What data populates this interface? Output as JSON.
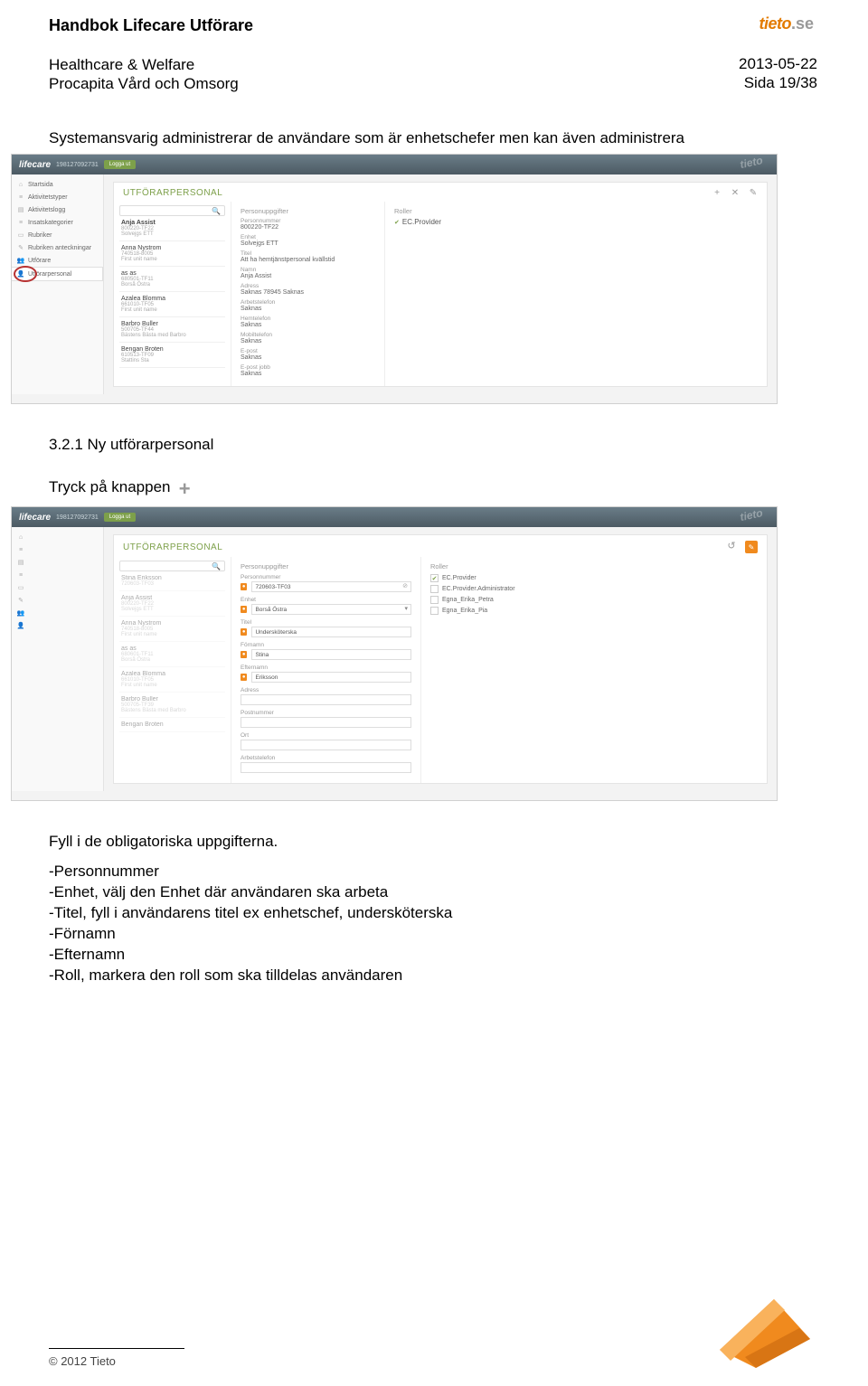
{
  "header": {
    "doc_title": "Handbok Lifecare Utförare",
    "division": "Healthcare & Welfare",
    "product": "Procapita Vård och Omsorg",
    "date": "2013-05-22",
    "page": "Sida 19/38",
    "logo_t": "tieto",
    "logo_se": ".se"
  },
  "intro": "Systemansvarig administrerar de användare som är enhetschefer men kan även administrera",
  "sec321_num": "3.2.1 Ny utförarpersonal",
  "tryck": "Tryck på knappen",
  "fyll": "Fyll i de obligatoriska uppgifterna.",
  "bullets": [
    "-Personnummer",
    "-Enhet, välj den Enhet där användaren ska arbeta",
    "-Titel, fyll i användarens titel ex enhetschef, undersköterska",
    "-Förnamn",
    "-Efternamn",
    "-Roll, markera den roll som ska tilldelas användaren"
  ],
  "footer": {
    "copyright": "© 2012 Tieto"
  },
  "app1": {
    "bar": {
      "logo": "lifecare",
      "code": "198127092731",
      "btn": "Logga ut"
    },
    "side": [
      "Startsida",
      "Aktivitetstyper",
      "Aktivitetslogg",
      "Insatskategorier",
      "Rubriker",
      "Rubriken anteckningar",
      "Utförare",
      "Utförarpersonal"
    ],
    "panel_title": "UTFÖRARPERSONAL",
    "persons": [
      {
        "nm": "Anja Assist",
        "ssn": "800220-TF22",
        "u": "Solvejgs ETT",
        "b": true
      },
      {
        "nm": "Anna Nystrom",
        "ssn": "740518-8005",
        "u": "First unit name"
      },
      {
        "nm": "as as",
        "ssn": "680501-TF11",
        "u": "Borså Östra"
      },
      {
        "nm": "Azalea Blomma",
        "ssn": "661010-TF05",
        "u": "First unit name"
      },
      {
        "nm": "Barbro Buller",
        "ssn": "500705-TF44",
        "u": "Bästens Bästa med Barbro"
      },
      {
        "nm": "Bengan Broten",
        "ssn": "610513-TF09",
        "u": "Stattins Sta"
      }
    ],
    "det": {
      "head": "Personuppgifter",
      "rows": [
        {
          "l": "Personnummer",
          "v": "800220-TF22"
        },
        {
          "l": "Enhet",
          "v": "Solvejgs ETT"
        },
        {
          "l": "Titel",
          "v": "Att ha hemtjänstpersonal kvällstid"
        },
        {
          "l": "Namn",
          "v": "Anja Assist"
        },
        {
          "l": "Adress",
          "v": "Saknas\n78945 Saknas"
        },
        {
          "l": "Arbetstelefon",
          "v": "Saknas"
        },
        {
          "l": "Hemtelefon",
          "v": "Saknas"
        },
        {
          "l": "Mobiltelefon",
          "v": "Saknas"
        },
        {
          "l": "E-post",
          "v": "Saknas"
        },
        {
          "l": "E-post jobb",
          "v": "Saknas"
        }
      ]
    },
    "roles_head": "Roller",
    "roles": [
      "EC.Provider"
    ]
  },
  "app2": {
    "bar": {
      "logo": "lifecare",
      "code": "198127092731",
      "btn": "Logga ut"
    },
    "panel_title": "UTFÖRARPERSONAL",
    "persons": [
      {
        "nm": "Stina Eriksson",
        "ssn": "720603-TF03"
      },
      {
        "nm": "Anja Assist",
        "ssn": "800220-TF22",
        "u": "Solvejgs ETT"
      },
      {
        "nm": "Anna Nystrom",
        "ssn": "740518-8005",
        "u": "First unit name"
      },
      {
        "nm": "as as",
        "ssn": "680601-TF11",
        "u": "Borså Östra"
      },
      {
        "nm": "Azalea Blomma",
        "ssn": "661010-TF05",
        "u": "First unit name"
      },
      {
        "nm": "Barbro Buller",
        "ssn": "500705-TF39",
        "u": "Bästens Bästa med Barbro"
      },
      {
        "nm": "Bengan Broten",
        "ssn": "",
        "u": ""
      }
    ],
    "form_head": "Personuppgifter",
    "form": [
      {
        "l": "Personnummer",
        "v": "720603-TF03",
        "req": true,
        "clr": true
      },
      {
        "l": "Enhet",
        "v": "Borså Östra",
        "req": true,
        "sel": true
      },
      {
        "l": "Titel",
        "v": "Undersköterska",
        "req": true
      },
      {
        "l": "Förnamn",
        "v": "Stina",
        "req": true
      },
      {
        "l": "Efternamn",
        "v": "Eriksson",
        "req": true
      },
      {
        "l": "Adress",
        "v": ""
      },
      {
        "l": "Postnummer",
        "v": ""
      },
      {
        "l": "Ort",
        "v": ""
      },
      {
        "l": "Arbetstelefon",
        "v": ""
      }
    ],
    "roles_head": "Roller",
    "roles": [
      {
        "n": "EC.Provider",
        "c": true
      },
      {
        "n": "EC.Provider.Administrator",
        "c": false
      },
      {
        "n": "Egna_Erika_Petra",
        "c": false
      },
      {
        "n": "Egna_Erika_Pia",
        "c": false
      }
    ]
  }
}
